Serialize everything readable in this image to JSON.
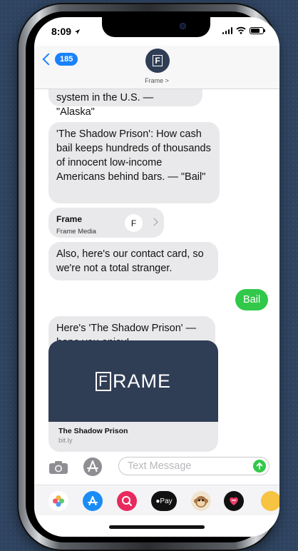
{
  "status_bar": {
    "time": "8:09"
  },
  "header": {
    "back_count": "185",
    "contact_name": "Frame",
    "contact_initial": "F"
  },
  "messages": {
    "clipped_text": "system in the U.S. — \"Alaska\"",
    "shadow_prison_text": "'The Shadow Prison': How cash bail keeps hundreds of thousands of innocent low-income Americans behind bars. — \"Bail\"",
    "contact_card": {
      "name": "Frame",
      "subtitle": "Frame Media",
      "initial": "F"
    },
    "contact_card_text": "Also, here's our contact card, so we're not a total stranger.",
    "sent_text": "Bail",
    "hope_text": "Here's 'The Shadow Prison' — hope you enjoy!",
    "link_card": {
      "logo_letter": "F",
      "logo_rest": "RAME",
      "title": "The Shadow Prison",
      "url": "bit.ly"
    }
  },
  "input": {
    "placeholder": "Text Message"
  },
  "app_drawer": {
    "apple_pay_label": "Pay"
  },
  "colors": {
    "imessage_blue": "#1a82fb",
    "sms_green": "#32c84a",
    "received_bubble": "#e9e9eb",
    "frame_navy": "#2f3d55"
  }
}
